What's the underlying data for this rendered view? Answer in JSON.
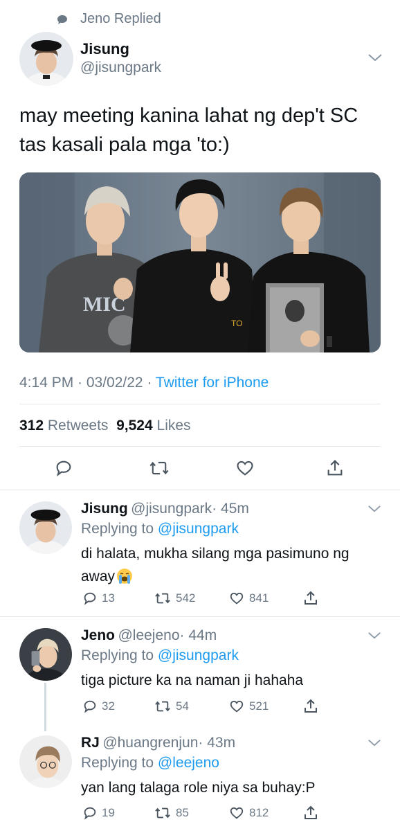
{
  "context": {
    "label": "Jeno Replied",
    "icon": "speech-bubble-icon"
  },
  "tweet": {
    "name": "Jisung",
    "handle": "@jisungpark",
    "text_line1": "may meeting kanina lahat ng dep't SC",
    "text_line2": "tas kasali pala mga 'to:)",
    "time": "4:14 PM · 03/02/22 · ",
    "source": "Twitter for iPhone",
    "retweets_count": "312",
    "retweets_label": "Retweets",
    "likes_count": "9,524",
    "likes_label": "Likes",
    "actions": [
      "reply-icon",
      "retweet-icon",
      "like-icon",
      "share-icon"
    ]
  },
  "replies": [
    {
      "name": "Jisung",
      "handle": "@jisungpark",
      "time": "· 45m",
      "replying_prefix": "Replying to ",
      "replying_to": "@jisungpark",
      "text_line1": "di halata, mukha silang mga pasimuno ng",
      "text_line2": "away",
      "emoji": "loudly-crying-face",
      "reply_count": "13",
      "retweet_count": "542",
      "like_count": "841"
    },
    {
      "name": "Jeno",
      "handle": "@leejeno",
      "time": "· 44m",
      "replying_prefix": "Replying to ",
      "replying_to": "@jisungpark",
      "text_line1": "tiga picture ka na naman ji hahaha",
      "reply_count": "32",
      "retweet_count": "54",
      "like_count": "521"
    },
    {
      "name": "RJ",
      "handle": "@huangrenjun",
      "time": "· 43m",
      "replying_prefix": "Replying to ",
      "replying_to": "@leejeno",
      "text_line1": "yan lang talaga role niya sa buhay:P",
      "reply_count": "19",
      "retweet_count": "85",
      "like_count": "812"
    }
  ],
  "colors": {
    "accent": "#1d9bf0",
    "muted": "#6b7885",
    "divider": "#e3e6e9"
  }
}
